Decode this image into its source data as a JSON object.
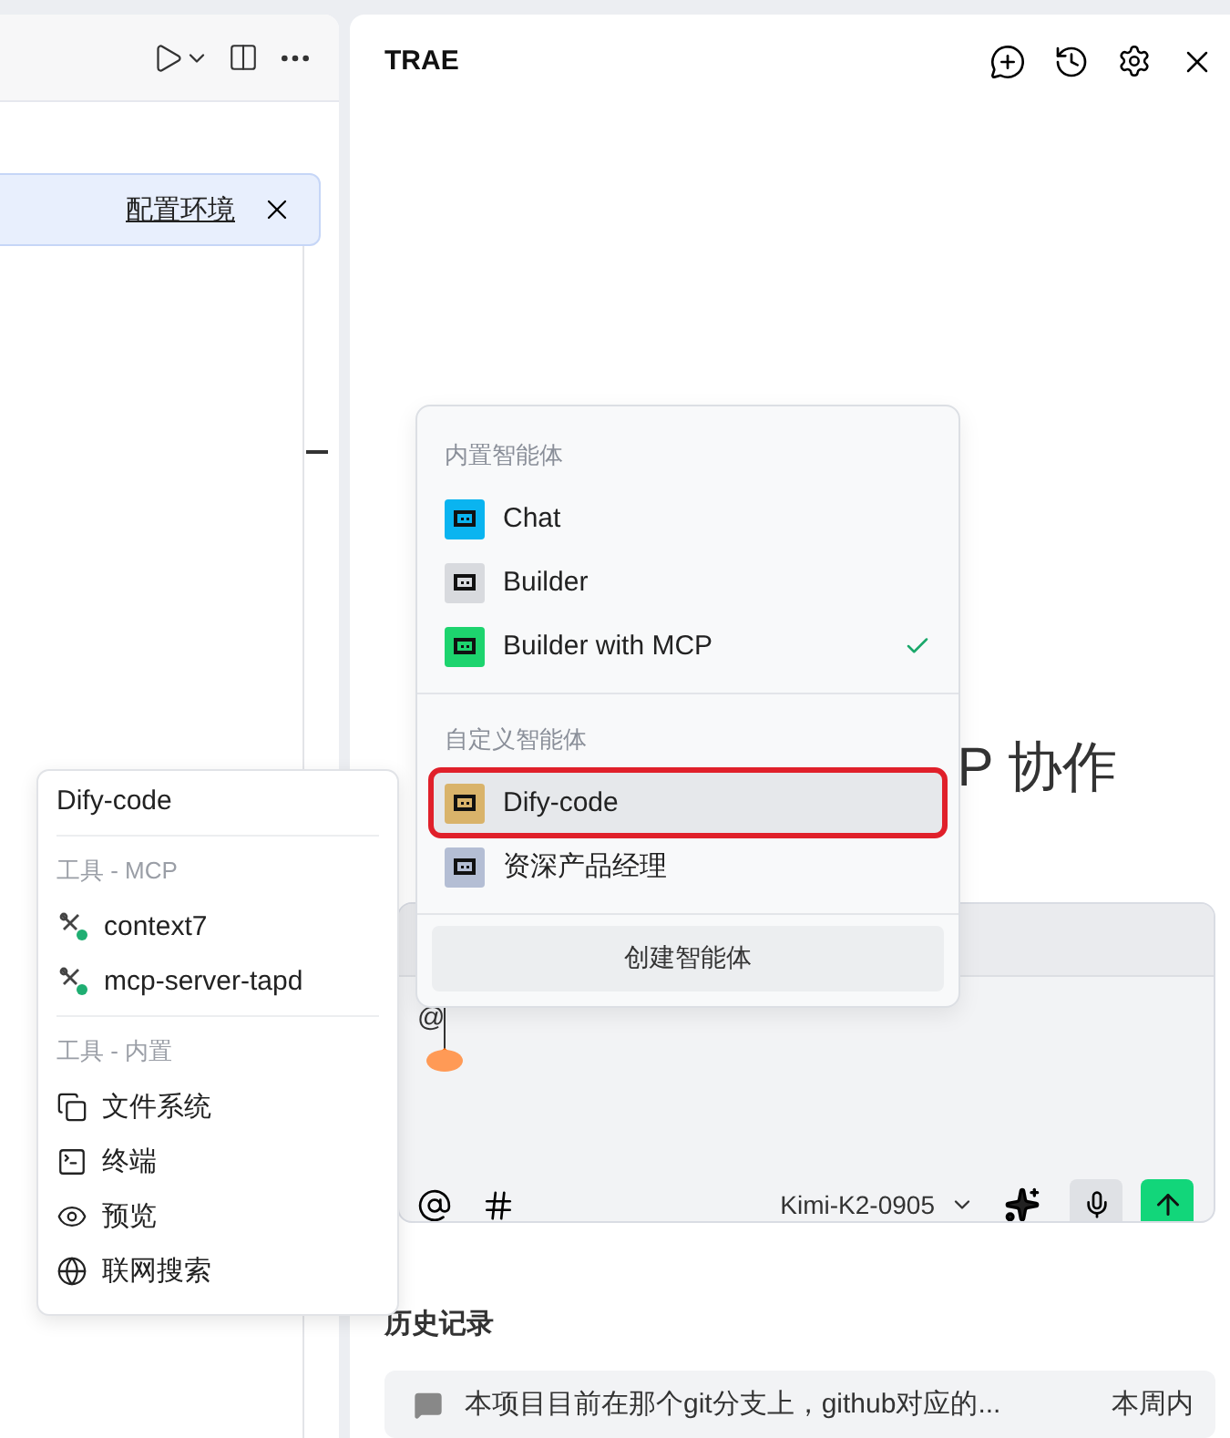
{
  "editor": {
    "banner": {
      "link": "配置环境"
    }
  },
  "panel": {
    "title": "TRAE",
    "heading": "P 协作",
    "input": {
      "value": "@",
      "model": "Kimi-K2-0905"
    },
    "history": {
      "title": "历史记录",
      "items": [
        {
          "text": "本项目目前在那个git分支上，github对应的...",
          "time": "本周内"
        }
      ]
    }
  },
  "agent_menu": {
    "sections": [
      {
        "title": "内置智能体",
        "items": [
          {
            "label": "Chat",
            "color": "#0ab4f0",
            "selected": false,
            "checked": false,
            "highlighted": false
          },
          {
            "label": "Builder",
            "color": "#d8dade",
            "selected": false,
            "checked": false,
            "highlighted": false
          },
          {
            "label": "Builder with MCP",
            "color": "#1dd46e",
            "selected": false,
            "checked": true,
            "highlighted": false
          }
        ]
      },
      {
        "title": "自定义智能体",
        "items": [
          {
            "label": "Dify-code",
            "color": "#d9b36a",
            "selected": true,
            "checked": false,
            "highlighted": true
          },
          {
            "label": "资深产品经理",
            "color": "#b4bed4",
            "selected": false,
            "checked": false,
            "highlighted": false
          }
        ]
      }
    ],
    "create_button": "创建智能体"
  },
  "tools_popup": {
    "title": "Dify-code",
    "sections": [
      {
        "title": "工具 - MCP",
        "items": [
          {
            "label": "context7",
            "kind": "mcp"
          },
          {
            "label": "mcp-server-tapd",
            "kind": "mcp"
          }
        ]
      },
      {
        "title": "工具 - 内置",
        "items": [
          {
            "label": "文件系统",
            "kind": "files"
          },
          {
            "label": "终端",
            "kind": "terminal"
          },
          {
            "label": "预览",
            "kind": "preview"
          },
          {
            "label": "联网搜索",
            "kind": "web"
          }
        ]
      }
    ]
  }
}
